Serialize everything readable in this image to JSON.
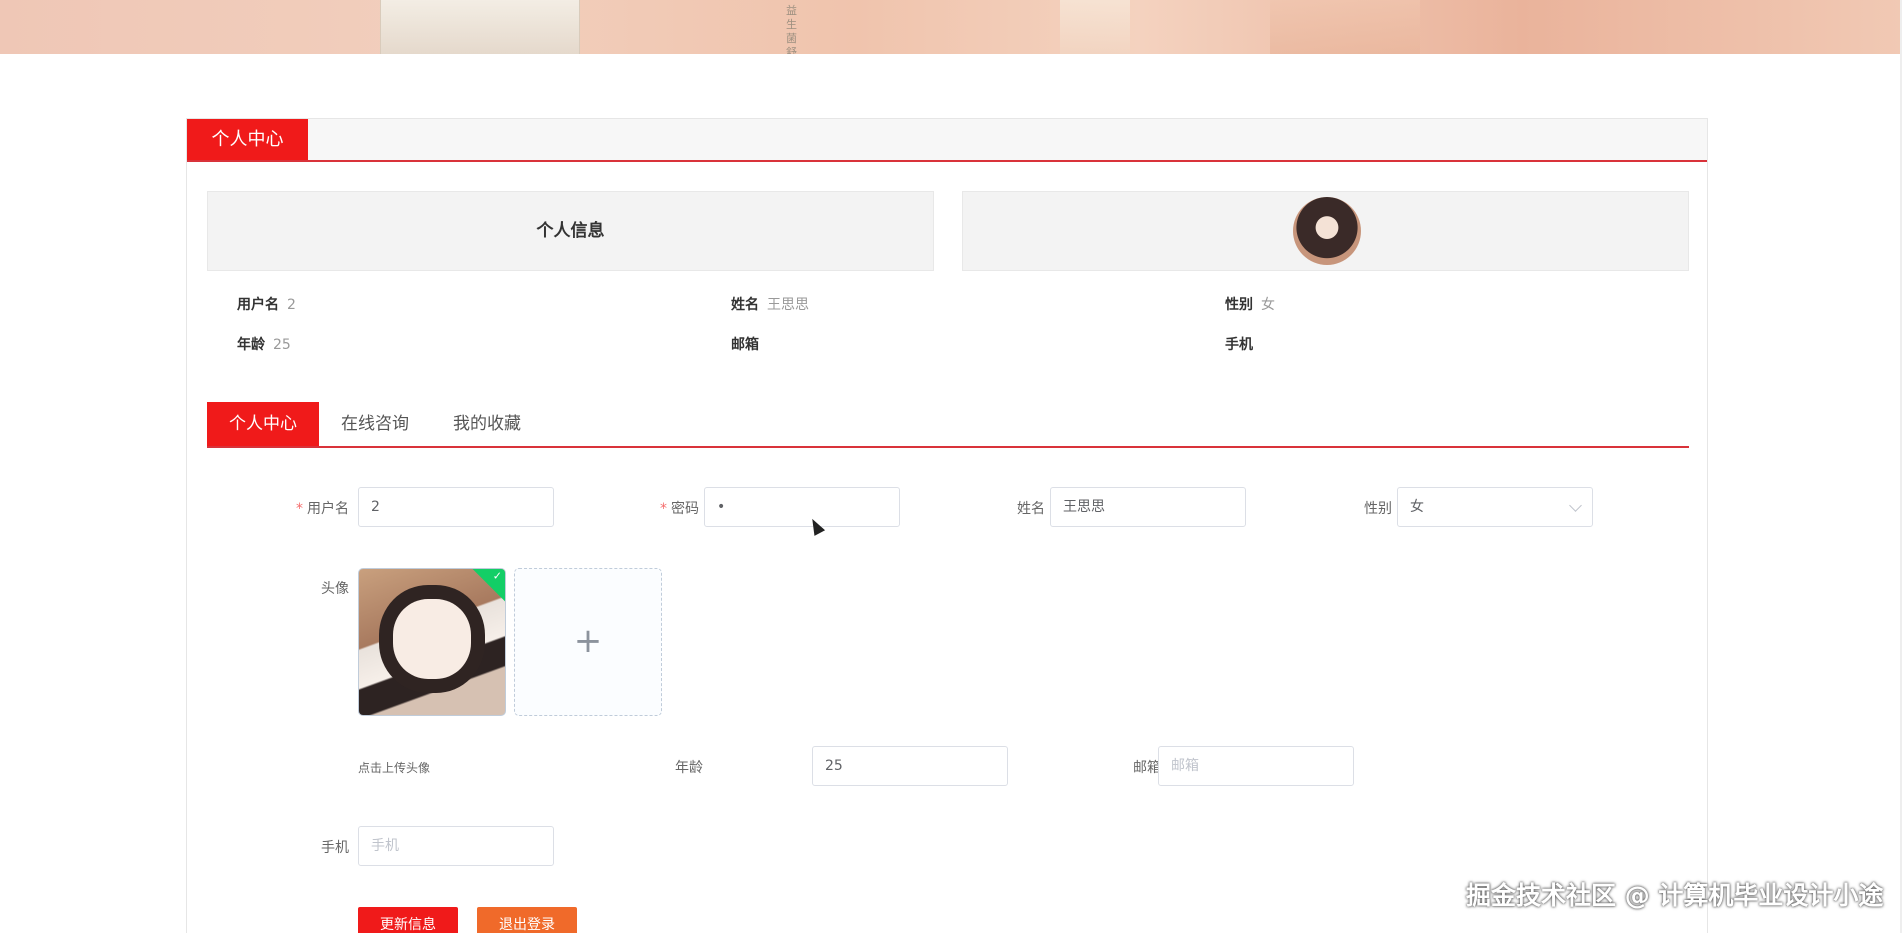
{
  "banner": {
    "bottle_text_line1": "益生菌舒缓修护精润乳",
    "bottle_text_line2": ""
  },
  "panel": {
    "tab_label": "个人中心",
    "info": {
      "title": "个人信息",
      "fields": [
        {
          "label": "用户名",
          "value": "2"
        },
        {
          "label": "姓名",
          "value": "王思思"
        },
        {
          "label": "性别",
          "value": "女"
        },
        {
          "label": "年龄",
          "value": "25"
        },
        {
          "label": "邮箱",
          "value": ""
        },
        {
          "label": "手机",
          "value": ""
        }
      ]
    },
    "tabs": [
      {
        "label": "个人中心",
        "active": true
      },
      {
        "label": "在线咨询",
        "active": false
      },
      {
        "label": "我的收藏",
        "active": false
      }
    ],
    "form": {
      "username": {
        "label": "用户名",
        "value": "2",
        "required": "*"
      },
      "password": {
        "label": "密码",
        "value": "•",
        "required": "*"
      },
      "name": {
        "label": "姓名",
        "value": "王思思"
      },
      "gender": {
        "label": "性别",
        "value": "女"
      },
      "avatar": {
        "label": "头像",
        "add_symbol": "+",
        "hint": "点击上传头像"
      },
      "age": {
        "label": "年龄",
        "value": "25"
      },
      "email": {
        "label": "邮箱",
        "placeholder": "邮箱"
      },
      "phone": {
        "label": "手机",
        "placeholder": "手机"
      }
    },
    "buttons": {
      "update": "更新信息",
      "logout": "退出登录"
    }
  },
  "watermark": "掘金技术社区 @ 计算机毕业设计小途",
  "colors": {
    "accent": "#f01a1a",
    "logout": "#f06a2a",
    "success": "#13ce66"
  }
}
